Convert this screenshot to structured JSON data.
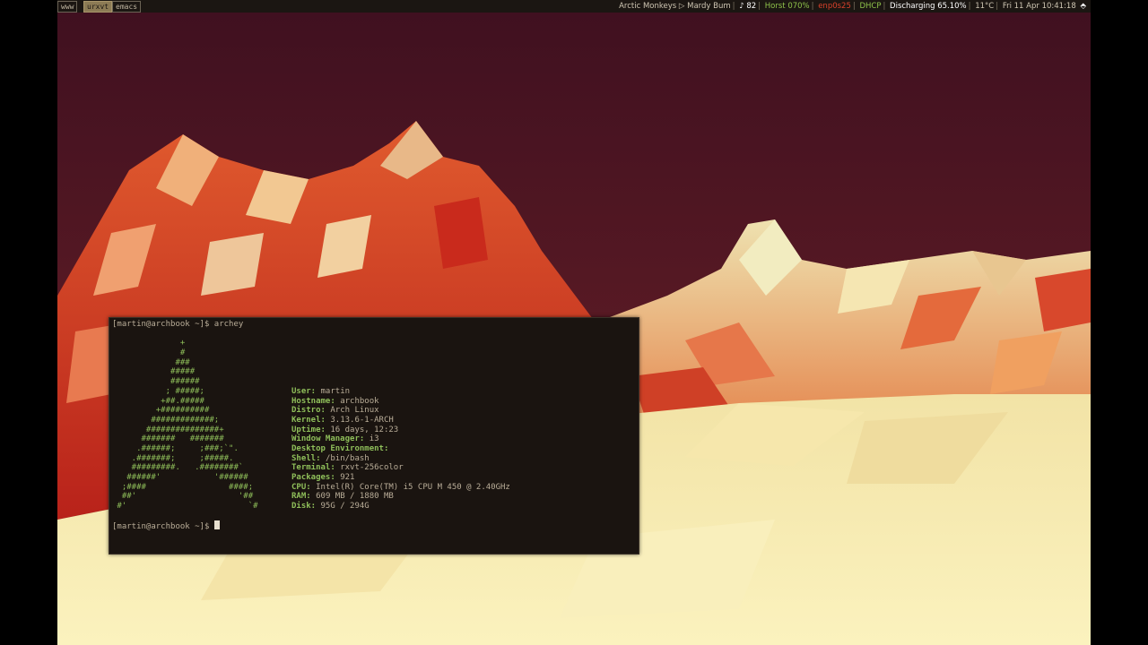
{
  "bar": {
    "workspaces": [
      "www",
      "urxvt",
      "emacs"
    ],
    "active_workspace": "urxvt",
    "now_playing": "Arctic Monkeys ▷ Mardy Bum",
    "volume": "♪ 82",
    "wifi": "Horst 070%",
    "ethernet": "enp0s25",
    "dhcp": "DHCP",
    "battery": "Discharging 65.10%",
    "temperature": "11°C",
    "datetime": "Fri 11 Apr 10:41:18",
    "colors": {
      "wifi": "#8fc34a",
      "ethernet": "#d9412b",
      "dhcp": "#8fc34a",
      "battery": "#ffffff"
    }
  },
  "terminal": {
    "prompt": "[martin@archbook ~]$ ",
    "command": "archey",
    "logo": [
      "              +",
      "              #",
      "             ###",
      "            #####",
      "            ######",
      "           ; #####;",
      "          +##.#####",
      "         +##########",
      "        #############;",
      "       ###############+",
      "      #######   #######",
      "     .######;     ;###;`\".",
      "    .#######;     ;#####.",
      "    #########.   .########`",
      "   ######'           '######",
      "  ;####                 ####;",
      "  ##'                     '##",
      " #'                         `#"
    ],
    "info": [
      {
        "key": "",
        "value": ""
      },
      {
        "key": "",
        "value": ""
      },
      {
        "key": "",
        "value": ""
      },
      {
        "key": "",
        "value": ""
      },
      {
        "key": "",
        "value": ""
      },
      {
        "key": "User:",
        "value": "martin"
      },
      {
        "key": "Hostname:",
        "value": "archbook"
      },
      {
        "key": "Distro:",
        "value": "Arch Linux"
      },
      {
        "key": "Kernel:",
        "value": "3.13.6-1-ARCH"
      },
      {
        "key": "Uptime:",
        "value": "16 days, 12:23"
      },
      {
        "key": "Window Manager:",
        "value": "i3"
      },
      {
        "key": "Desktop Environment:",
        "value": ""
      },
      {
        "key": "Shell:",
        "value": "/bin/bash"
      },
      {
        "key": "Terminal:",
        "value": "rxvt-256color"
      },
      {
        "key": "Packages:",
        "value": "921"
      },
      {
        "key": "CPU:",
        "value": "Intel(R) Core(TM) i5 CPU M 450 @ 2.40GHz"
      },
      {
        "key": "RAM:",
        "value": "609 MB / 1880 MB"
      },
      {
        "key": "Disk:",
        "value": "95G / 294G"
      }
    ]
  }
}
